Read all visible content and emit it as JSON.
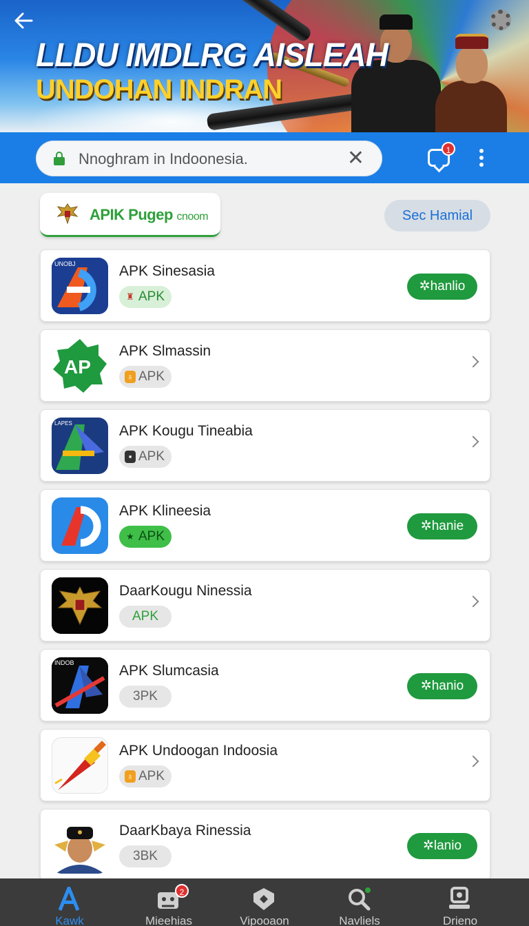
{
  "hero": {
    "title": "LLDU IMDLRG AISLEAH",
    "subtitle": "UNDOHAN INDRAN"
  },
  "search": {
    "value": "Nnoghram in Indoonesia.",
    "clear_icon": "✕",
    "notification_count": "1"
  },
  "filters": {
    "primary_label": "APIK Pugep",
    "primary_suffix": "cnoom",
    "secondary_label": "Sec Hamial"
  },
  "apps": [
    {
      "name": "APK Sinesasia",
      "tag": "APK",
      "action": "✲hanlio"
    },
    {
      "name": "APK Slmassin",
      "tag": "APK"
    },
    {
      "name": "APK Kougu Tineabia",
      "tag": "APK"
    },
    {
      "name": "APK Klineesia",
      "tag": "APK",
      "action": "✲hanie"
    },
    {
      "name": "DaarKougu Ninessia",
      "tag": "APK"
    },
    {
      "name": "APK Slumcasia",
      "tag": "3PK",
      "action": "✲hanio"
    },
    {
      "name": "APK Undoogan Indoosia",
      "tag": "APK"
    },
    {
      "name": "DaarKbaya Rinessia",
      "tag": "3BK",
      "action": "✲lanio"
    }
  ],
  "icon_labels": {
    "app1": "UNOBJ",
    "app3": "LAPES",
    "app6": "INDOB"
  },
  "nav": {
    "items": [
      {
        "label": "Kawk"
      },
      {
        "label": "Miеehias",
        "badge": "2"
      },
      {
        "label": "Vipooaon"
      },
      {
        "label": "Navliels"
      },
      {
        "label": "Driеno"
      }
    ]
  },
  "colors": {
    "accent_blue": "#1a7ee6",
    "install_green": "#1f9a3e",
    "primary_green": "#2ea03a",
    "nav_active": "#2d8df0"
  }
}
